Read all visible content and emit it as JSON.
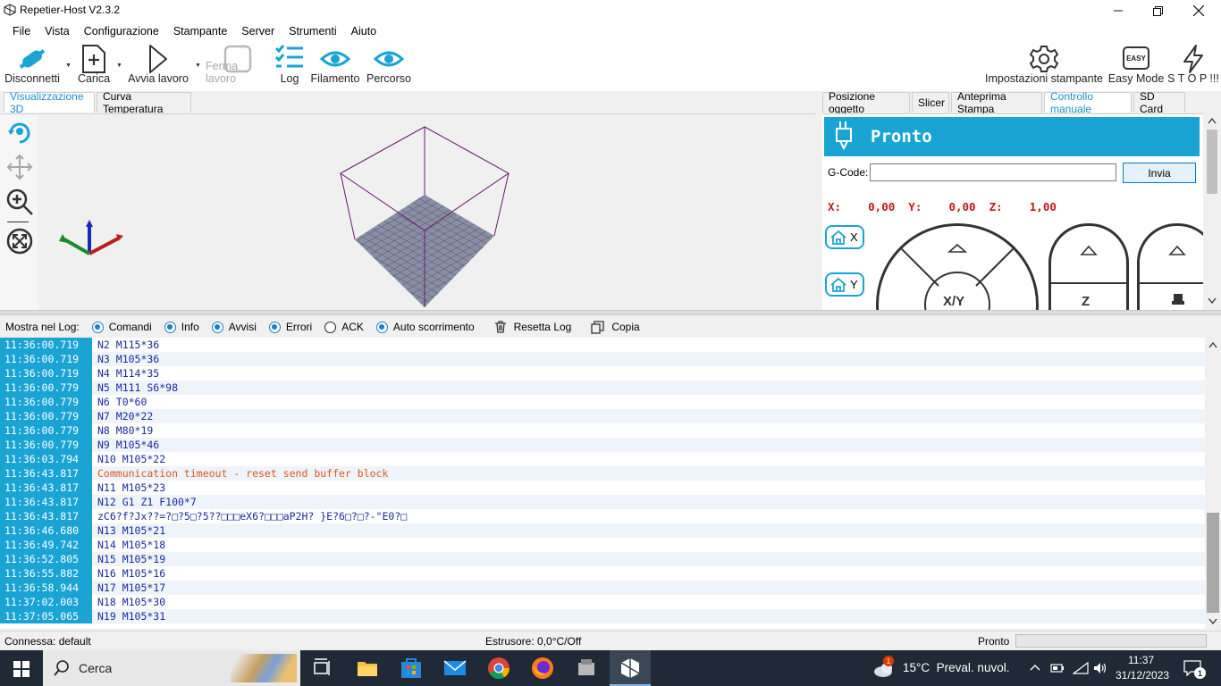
{
  "window": {
    "title": "Repetier-Host V2.3.2"
  },
  "menu": [
    "File",
    "Vista",
    "Configurazione",
    "Stampante",
    "Server",
    "Strumenti",
    "Aiuto"
  ],
  "toolbar": {
    "disconnect": "Disconnetti",
    "load": "Carica",
    "start_job": "Avvia lavoro",
    "stop_job": "Ferma lavoro",
    "log": "Log",
    "filament": "Filamento",
    "path": "Percorso",
    "printer_settings": "Impostazioni stampante",
    "easy_mode": "Easy Mode",
    "easy_badge": "EASY",
    "stop": "S T O P !!!"
  },
  "left_tabs": [
    "Visualizzazione 3D",
    "Curva Temperatura"
  ],
  "right_tabs": [
    "Posizione oggetto",
    "Slicer",
    "Anteprima Stampa",
    "Controllo manuale",
    "SD Card"
  ],
  "manual_control": {
    "status": "Pronto",
    "gcode_label": "G-Code:",
    "gcode_value": "",
    "send_label": "Invia",
    "coords": "X:    0,00  Y:    0,00  Z:    1,00",
    "home_x": "X",
    "home_y": "Y",
    "jog_xy_label": "X/Y",
    "jog_z_label": "Z"
  },
  "log_toolbar": {
    "label": "Mostra nel Log:",
    "options": [
      {
        "label": "Comandi",
        "checked": true
      },
      {
        "label": "Info",
        "checked": true
      },
      {
        "label": "Avvisi",
        "checked": true
      },
      {
        "label": "Errori",
        "checked": true
      },
      {
        "label": "ACK",
        "checked": false
      },
      {
        "label": "Auto scorrimento",
        "checked": true
      }
    ],
    "reset": "Resetta Log",
    "copy": "Copia"
  },
  "log": [
    {
      "t": "11:36:00.719",
      "m": "N2 M115*36"
    },
    {
      "t": "11:36:00.719",
      "m": "N3 M105*36"
    },
    {
      "t": "11:36:00.719",
      "m": "N4 M114*35"
    },
    {
      "t": "11:36:00.779",
      "m": "N5 M111 S6*98"
    },
    {
      "t": "11:36:00.779",
      "m": "N6 T0*60"
    },
    {
      "t": "11:36:00.779",
      "m": "N7 M20*22"
    },
    {
      "t": "11:36:00.779",
      "m": "N8 M80*19"
    },
    {
      "t": "11:36:00.779",
      "m": "N9 M105*46"
    },
    {
      "t": "11:36:03.794",
      "m": "N10 M105*22"
    },
    {
      "t": "11:36:43.817",
      "m": "Communication timeout - reset send buffer block",
      "warn": true
    },
    {
      "t": "11:36:43.817",
      "m": "N11 M105*23"
    },
    {
      "t": "11:36:43.817",
      "m": "N12 G1 Z1 F100*7"
    },
    {
      "t": "11:36:43.817",
      "m": "zC6?f?Jx??=?□?5□?5??□□□eX6?□□□aP2H? }E?6□?□?-\"E0?□"
    },
    {
      "t": "11:36:46.680",
      "m": "N13 M105*21"
    },
    {
      "t": "11:36:49.742",
      "m": "N14 M105*18"
    },
    {
      "t": "11:36:52.805",
      "m": "N15 M105*19"
    },
    {
      "t": "11:36:55.882",
      "m": "N16 M105*16"
    },
    {
      "t": "11:36:58.944",
      "m": "N17 M105*17"
    },
    {
      "t": "11:37:02.003",
      "m": "N18 M105*30"
    },
    {
      "t": "11:37:05.065",
      "m": "N19 M105*31"
    }
  ],
  "statusbar": {
    "connection": "Connessa: default",
    "extruder": "Estrusore: 0,0°C/Off",
    "state": "Pronto",
    "progress": 0
  },
  "taskbar": {
    "search": "Cerca",
    "weather": "15°C  Preval. nuvol.",
    "weather_badge": "1",
    "time": "11:37",
    "date": "31/12/2023",
    "notif_count": "1"
  },
  "colors": {
    "accent": "#1aa4d4",
    "warn": "#e0571b",
    "coord": "#c01818",
    "log_text": "#1a2aa0"
  }
}
